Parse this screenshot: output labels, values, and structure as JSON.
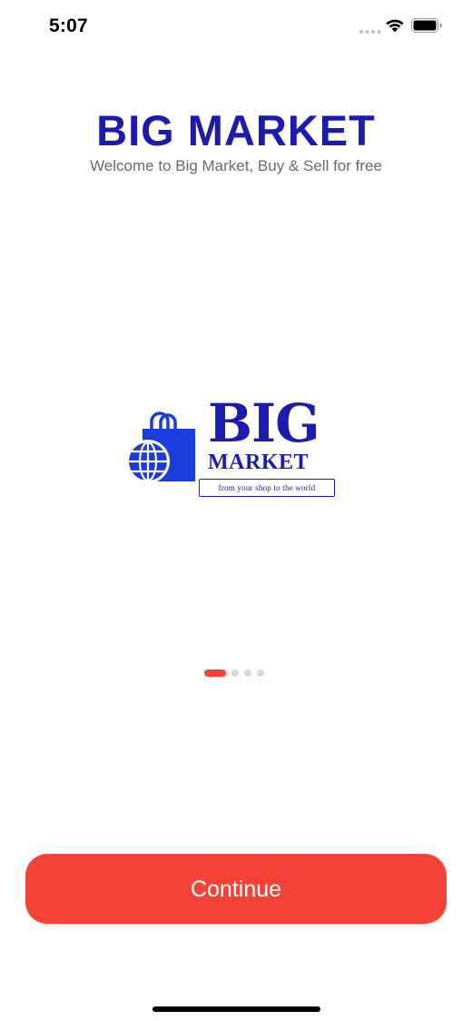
{
  "status_bar": {
    "time": "5:07",
    "icons": [
      "signal-dots-icon",
      "wifi-icon",
      "battery-icon"
    ]
  },
  "header": {
    "title": "BIG MARKET",
    "subtitle": "Welcome to Big Market, Buy & Sell for free"
  },
  "logo": {
    "line1": "BIG",
    "line2": "MARKET",
    "tagline": "from your shop to the world",
    "icons": [
      "shopping-bag-icon",
      "globe-icon"
    ]
  },
  "page_indicator": {
    "total": 4,
    "active_index": 0
  },
  "actions": {
    "continue_label": "Continue"
  },
  "colors": {
    "brand_blue": "#1b1bb0",
    "accent_red": "#f44336",
    "subtitle_gray": "#6a6a6a",
    "dot_inactive": "#d8d8d8"
  }
}
